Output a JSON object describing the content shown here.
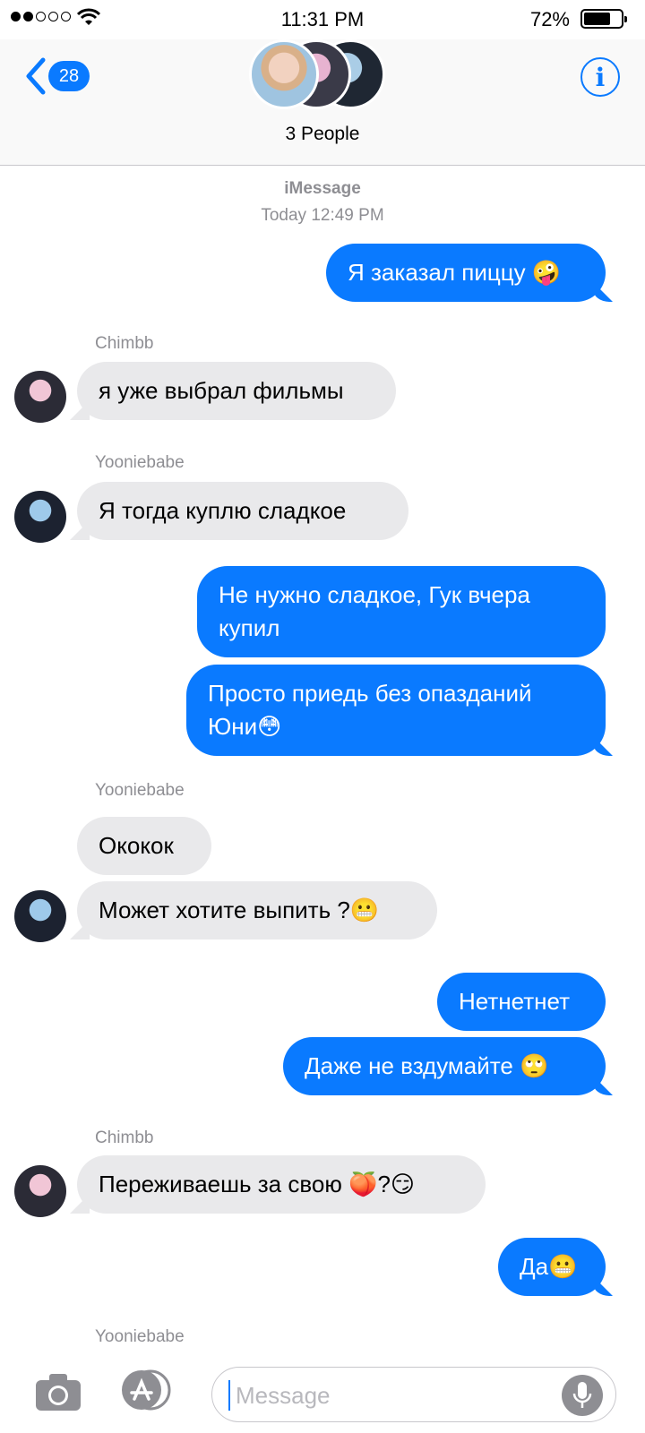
{
  "status_bar": {
    "time": "11:31 PM",
    "battery": "72%",
    "signal_bars": 2
  },
  "header": {
    "back_count": "28",
    "group_name": "3 People",
    "info_icon": "info-icon"
  },
  "thread": {
    "service": "iMessage",
    "timestamp": "Today 12:49 PM",
    "messages": [
      {
        "direction": "out",
        "text": "Я заказал пиццу 🤪"
      },
      {
        "direction": "in",
        "sender": "Chimbb",
        "text": "я уже выбрал фильмы"
      },
      {
        "direction": "in",
        "sender": "Yooniebabe",
        "text": "Я тогда куплю сладкое"
      },
      {
        "direction": "out",
        "text": "Не нужно сладкое, Гук вчера купил"
      },
      {
        "direction": "out",
        "text": "Просто приедь без опазданий Юни😳"
      },
      {
        "direction": "in",
        "sender": "Yooniebabe",
        "text": "Ококок"
      },
      {
        "direction": "in",
        "text": "Может хотите выпить ?😬"
      },
      {
        "direction": "out",
        "text": "Нетнетнет"
      },
      {
        "direction": "out",
        "text": "Даже не вздумайте 🙄"
      },
      {
        "direction": "in",
        "sender": "Chimbb",
        "text": "Переживаешь за свою 🍑?😏"
      },
      {
        "direction": "out",
        "text": "Да😬"
      }
    ],
    "trailing_sender": "Yooniebabe"
  },
  "input": {
    "placeholder": "Message",
    "camera_icon": "camera-icon",
    "apps_icon": "app-store-icon",
    "mic_icon": "microphone-icon"
  },
  "colors": {
    "accent": "#0a7aff",
    "incoming_bubble": "#e9e9eb",
    "meta_text": "#8e8e93"
  }
}
